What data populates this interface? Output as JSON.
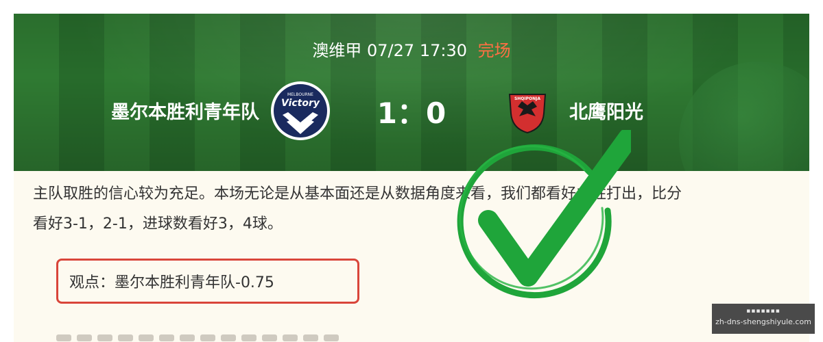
{
  "match": {
    "league": "澳维甲",
    "date": "07/27",
    "time": "17:30",
    "status": "完场",
    "home_team": "墨尔本胜利青年队",
    "away_team": "北鹰阳光",
    "score": "1：0",
    "home_logo_text": "Victory",
    "home_logo_small": "MELBOURNE",
    "away_logo_text": "SHQIPONJA",
    "colors": {
      "status": "#ff7043",
      "pitch": "#2f7a32"
    }
  },
  "article": {
    "para1_line1": "主队取胜的信心较为充足。本场无论是从基本面还是从数据角度来看，我们都看好主胜打出，比分",
    "para1_line2": "看好3-1，2-1，进球数看好3，4球。",
    "opinion": "观点：墨尔本胜利青年队-0.75",
    "opinion_border_color": "#d9453a"
  },
  "stamp": {
    "icon": "check-stamp-icon",
    "color": "#1fa53a"
  },
  "watermark": {
    "top": "▪▪▪▪▪▪▪",
    "url": "zh-dns-shengshiyule.com"
  }
}
